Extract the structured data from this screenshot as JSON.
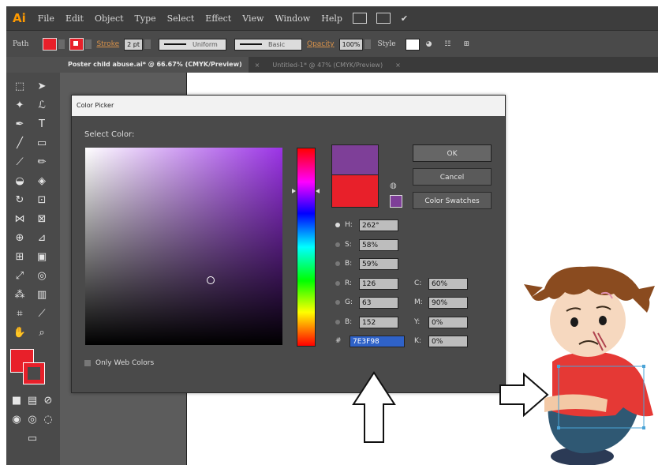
{
  "menubar": {
    "logo": "Ai",
    "items": [
      "File",
      "Edit",
      "Object",
      "Type",
      "Select",
      "Effect",
      "View",
      "Window",
      "Help"
    ]
  },
  "controlbar": {
    "path_label": "Path",
    "stroke_link": "Stroke",
    "stroke_weight": "2 pt",
    "profile_uniform": "Uniform",
    "profile_basic": "Basic",
    "opacity_link": "Opacity",
    "opacity_value": "100%",
    "style_label": "Style"
  },
  "tabs": {
    "active": "Poster child abuse.ai* @ 66.67% (CMYK/Preview)",
    "inactive": "Untitled-1* @ 47% (CMYK/Preview)"
  },
  "colors": {
    "fill": "#E8202A",
    "current_color": "#7E3F98",
    "original_color": "#E8202A",
    "hex_highlight": "#2F62C8"
  },
  "dialog": {
    "title": "Color Picker",
    "select_color_label": "Select Color:",
    "ok": "OK",
    "cancel": "Cancel",
    "swatches": "Color Swatches",
    "only_web_colors": "Only Web Colors",
    "hsb": {
      "h_label": "H:",
      "h": "262°",
      "s_label": "S:",
      "s": "58%",
      "b_label": "B:",
      "b": "59%"
    },
    "rgb": {
      "r_label": "R:",
      "r": "126",
      "g_label": "G:",
      "g": "63",
      "b_label": "B:",
      "b": "152"
    },
    "cmyk": {
      "c_label": "C:",
      "c": "60%",
      "m_label": "M:",
      "m": "90%",
      "y_label": "Y:",
      "y": "0%",
      "k_label": "K:",
      "k": "0%"
    },
    "hex_label": "#",
    "hex": "7E3F98"
  }
}
